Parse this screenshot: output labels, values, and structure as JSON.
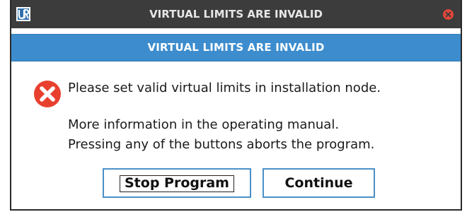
{
  "titlebar": {
    "logo_icon": "ur-logo-icon",
    "title": "VIRTUAL LIMITS ARE INVALID",
    "close_icon": "close-icon",
    "background": "#3c3c3c"
  },
  "header": {
    "title": "VIRTUAL LIMITS ARE INVALID",
    "background": "#3d8dce"
  },
  "message": {
    "icon": "error-icon",
    "icon_color": "#e8402f",
    "line1": "Please set valid virtual limits in installation node.",
    "line2": "More information in the operating manual.",
    "line3": "Pressing any of the buttons aborts the program."
  },
  "buttons": {
    "stop_label": "Stop Program",
    "continue_label": "Continue",
    "border_color": "#4a90c8"
  }
}
